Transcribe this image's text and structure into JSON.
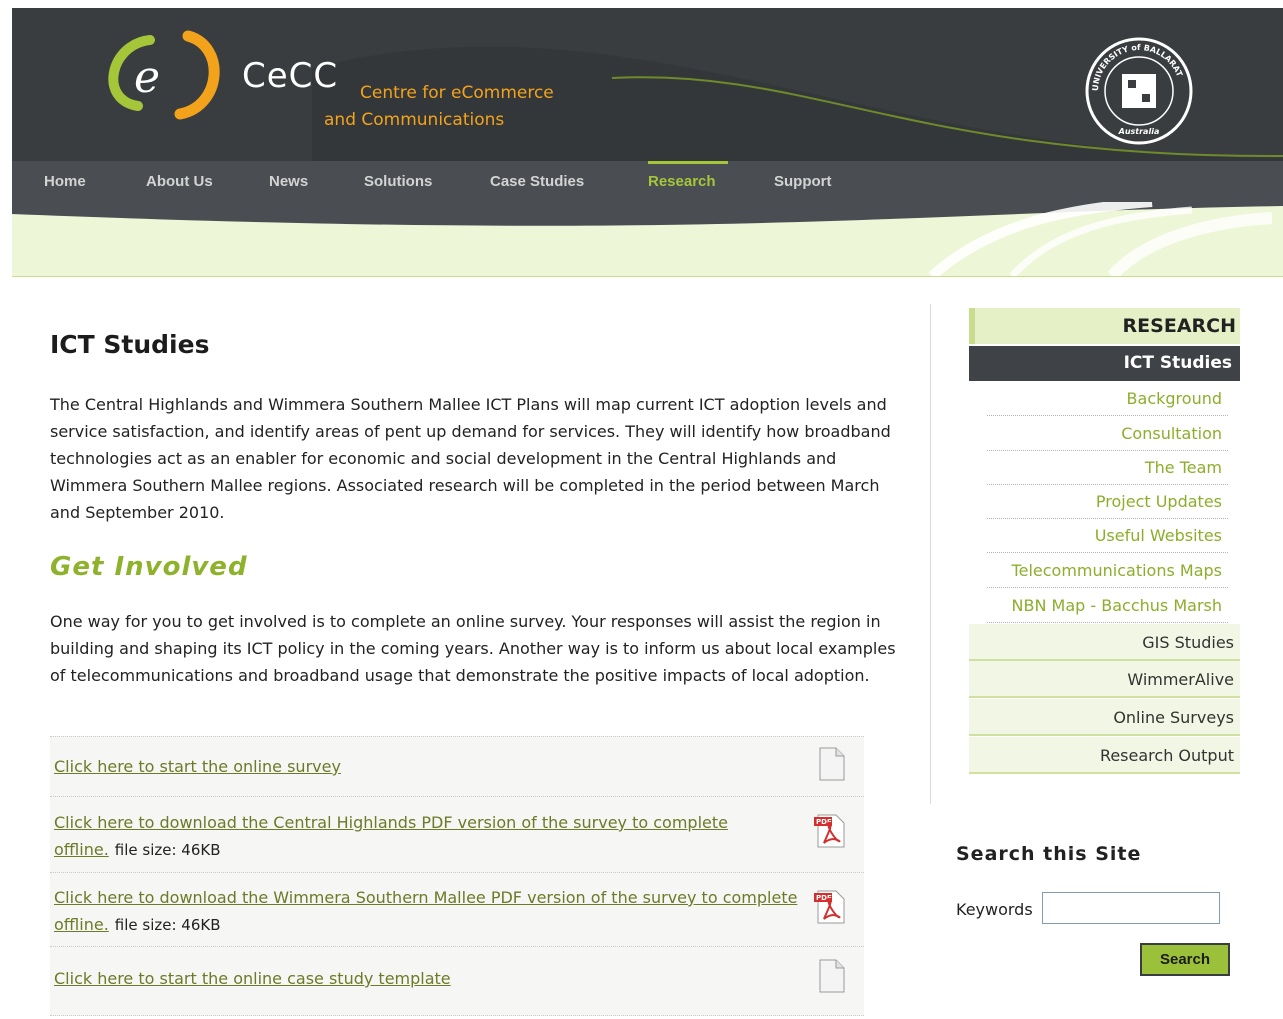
{
  "header": {
    "logo_text": "CeCC",
    "logo_tagline_1": "Centre for eCommerce",
    "logo_tagline_2": "and Communications",
    "seal_text": "UNIVERSITY of BALLARAT",
    "seal_subtext": "Australia"
  },
  "nav": {
    "items": [
      "Home",
      "About Us",
      "News",
      "Solutions",
      "Case Studies",
      "Research",
      "Support"
    ],
    "active": "Research"
  },
  "main": {
    "title": "ICT Studies",
    "intro": "The Central Highlands and Wimmera Southern Mallee ICT Plans will map current ICT adoption levels and service satisfaction, and identify areas of pent up demand for services. They will identify how broadband technologies act as an enabler for economic and social development in the Central Highlands and Wimmera Southern Mallee regions. Associated research will be completed in the period between March and September 2010.",
    "get_involved_heading": "Get Involved",
    "get_involved_text": "One way for you to get involved is to complete an online survey. Your responses will assist the region in building and shaping its ICT policy in the coming years. Another way is to inform us about local examples of telecommunications and broadband usage that demonstrate the positive impacts of local adoption.",
    "downloads": [
      {
        "link": "Click here to start the online survey",
        "size": "",
        "icon": "document-icon"
      },
      {
        "link": "Click here to download the Central Highlands PDF version of the survey to complete offline.",
        "size": "file size: 46KB",
        "icon": "pdf-icon"
      },
      {
        "link": "Click here to download the Wimmera Southern Mallee PDF version of the survey to complete offline.",
        "size": "file size: 46KB",
        "icon": "pdf-icon"
      },
      {
        "link": "Click here to start the online case study template",
        "size": "",
        "icon": "document-icon"
      }
    ]
  },
  "sidebar": {
    "heading": "RESEARCH",
    "active_item": "ICT Studies",
    "sub_items": [
      "Background",
      "Consultation",
      "The Team",
      "Project Updates",
      "Useful Websites",
      "Telecommunications Maps",
      "NBN Map - Bacchus Marsh"
    ],
    "main_items": [
      "GIS Studies",
      "WimmerAlive",
      "Online Surveys",
      "Research Output"
    ]
  },
  "search": {
    "title": "Search this Site",
    "keywords_label": "Keywords",
    "keywords_value": "",
    "button_label": "Search"
  },
  "colors": {
    "header_bg": "#3a3d40",
    "accent_green": "#a6c63a",
    "logo_orange": "#f2a31b"
  }
}
